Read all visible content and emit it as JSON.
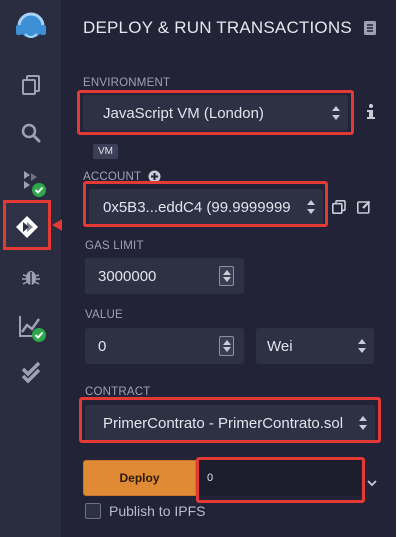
{
  "panel": {
    "title": "DEPLOY & RUN TRANSACTIONS"
  },
  "environment": {
    "label": "ENVIRONMENT",
    "value": "JavaScript VM (London)",
    "badge": "VM"
  },
  "account": {
    "label": "ACCOUNT",
    "value": "0x5B3...eddC4 (99.9999999"
  },
  "gas_limit": {
    "label": "GAS LIMIT",
    "value": "3000000"
  },
  "value": {
    "label": "VALUE",
    "amount": "0",
    "unit": "Wei"
  },
  "contract": {
    "label": "CONTRACT",
    "value": "PrimerContrato - PrimerContrato.sol"
  },
  "deploy": {
    "button_label": "Deploy",
    "input_value": "0",
    "publish_label": "Publish to IPFS",
    "publish_checked": false
  },
  "sidebar": {
    "items": [
      {
        "icon": "remix-logo-icon",
        "active": false
      },
      {
        "icon": "file-explorer-icon",
        "active": false
      },
      {
        "icon": "search-icon",
        "active": false
      },
      {
        "icon": "solidity-compiler-icon",
        "active": false,
        "status": "success"
      },
      {
        "icon": "deploy-run-icon",
        "active": true
      },
      {
        "icon": "debugger-icon",
        "active": false
      },
      {
        "icon": "analysis-icon",
        "active": false,
        "status": "success"
      },
      {
        "icon": "unit-testing-icon",
        "active": false
      }
    ]
  },
  "colors": {
    "highlight": "#e53935",
    "deploy_button": "#e08a35",
    "success": "#2ca84a",
    "panel_bg": "#222336"
  }
}
